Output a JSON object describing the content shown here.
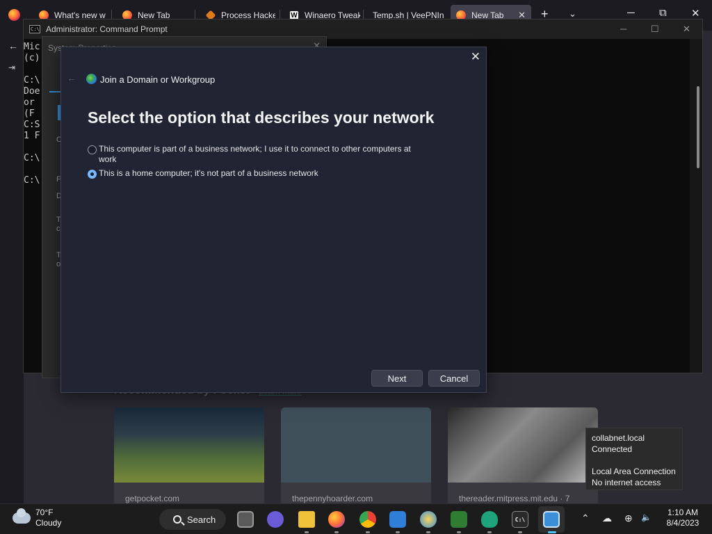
{
  "browser": {
    "tabs": [
      {
        "label": "What's new w",
        "active": false
      },
      {
        "label": "New Tab",
        "active": false
      },
      {
        "label": "Process Hacke",
        "active": false
      },
      {
        "label": "Winaero Tweak",
        "active": false
      },
      {
        "label": "Temp.sh | VeePNIn",
        "active": false
      },
      {
        "label": "New Tab",
        "active": true
      }
    ],
    "new_tab_glyph": "+",
    "list_all_tabs_glyph": "⌄",
    "tab_close_glyph": "✕"
  },
  "window_controls": {
    "minimize": "─",
    "maximize": "⧉",
    "close": "✕"
  },
  "pocket": {
    "title": "Recommended by Pocket",
    "link": "Learn more",
    "cards": [
      {
        "source": "getpocket.com",
        "tint": "#3b5a34"
      },
      {
        "source": "thepennyhoarder.com",
        "tint": "#3f4f59"
      },
      {
        "source": "thereader.mitpress.mit.edu · 7",
        "tint": "#6a6a6a"
      }
    ]
  },
  "cmd": {
    "title": "Administrator: Command Prompt",
    "lines": [
      "Mic",
      "(c)",
      "",
      "C:\\",
      "Doe",
      "or",
      "(F",
      "C:S",
      "1 F",
      "",
      "C:\\",
      "",
      "C:\\"
    ]
  },
  "sysprop": {
    "title": "System Properties",
    "fragments": [
      "C",
      "F",
      "D",
      "T",
      "c",
      "T",
      "o"
    ]
  },
  "wizard": {
    "title": "Join a Domain or Workgroup",
    "heading": "Select the option that describes your network",
    "options": [
      {
        "label": "This computer is part of a business network; I use it to connect to other computers at work",
        "checked": false
      },
      {
        "label": "This is a home computer; it's not part of a business network",
        "checked": true
      }
    ],
    "next_label": "Next",
    "cancel_label": "Cancel",
    "close_glyph": "✕",
    "back_glyph": "←"
  },
  "network_tooltip": {
    "line1": "collabnet.local",
    "line2": "Connected",
    "line3": "Local Area Connection",
    "line4": "No internet access"
  },
  "taskbar": {
    "weather_temp": "70°F",
    "weather_desc": "Cloudy",
    "search_label": "Search",
    "time": "1:10 AM",
    "date": "8/4/2023",
    "icons": [
      "start-icon",
      "task-view-icon",
      "meet-icon",
      "file-explorer-icon",
      "firefox-icon",
      "chrome-icon",
      "rdp-icon",
      "globe-app-icon",
      "sheet-app-icon",
      "vpn-shield-icon",
      "cmd-icon",
      "system-properties-icon"
    ],
    "tray_glyphs": {
      "chevron": "⌃",
      "onedrive": "☁",
      "network": "⊕",
      "volume": "🔈"
    }
  },
  "colors": {
    "accent": "#79b8ff",
    "wizard_bg": "#202433",
    "taskbar_bg": "#1c1c1c"
  }
}
